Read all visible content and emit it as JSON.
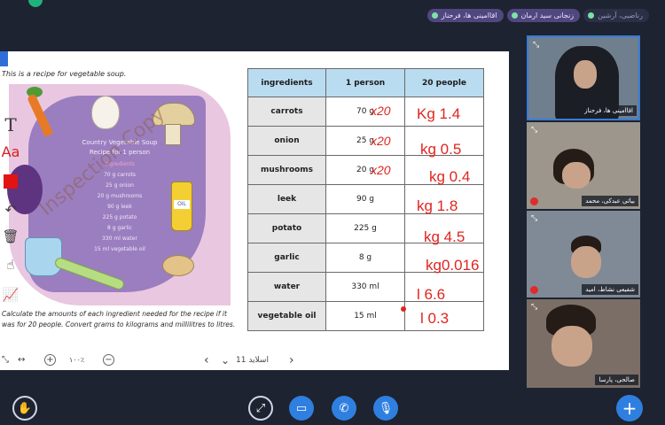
{
  "topbar": {
    "participants": [
      {
        "name": "اقاامینی ها، فرحناز",
        "muted": false
      },
      {
        "name": "زنجانی سید ارمان",
        "muted": false
      },
      {
        "name": "رناضیی، آرشین",
        "muted": true
      }
    ]
  },
  "slide": {
    "intro": "This is a recipe for vegetable soup.",
    "poster_title_1": "Country Vegetable Soup",
    "poster_title_2": "Recipe for 1 person",
    "poster_lines": [
      "Ingredients",
      "70 g carrots",
      "25 g onion",
      "20 g mushrooms",
      "90 g leek",
      "225 g potato",
      "8 g garlic",
      "330 ml water",
      "15 ml vegetable oil"
    ],
    "oil_label": "OIL",
    "watermark": "Inspection Copy",
    "task": "Calculate the amounts of each ingredient needed for the recipe if it was for 20 people. Convert grams to kilograms and millilitres to litres.",
    "table": {
      "headers": [
        "ingredients",
        "1 person",
        "20 people"
      ],
      "rows": [
        {
          "ingredient": "carrots",
          "per_person": "70 g",
          "twenty": ""
        },
        {
          "ingredient": "onion",
          "per_person": "25 g",
          "twenty": ""
        },
        {
          "ingredient": "mushrooms",
          "per_person": "20 g",
          "twenty": ""
        },
        {
          "ingredient": "leek",
          "per_person": "90 g",
          "twenty": ""
        },
        {
          "ingredient": "potato",
          "per_person": "225 g",
          "twenty": ""
        },
        {
          "ingredient": "garlic",
          "per_person": "8 g",
          "twenty": ""
        },
        {
          "ingredient": "water",
          "per_person": "330 ml",
          "twenty": ""
        },
        {
          "ingredient": "vegetable oil",
          "per_person": "15 ml",
          "twenty": ""
        }
      ]
    },
    "ink": {
      "mult": [
        "x20",
        "x20",
        "x20"
      ],
      "answers": [
        "Kg 1.4",
        "kg 0.5",
        "kg 0.4",
        "kg 1.8",
        "kg 4.5",
        "kg0.016",
        "l 6.6",
        "l 0.3"
      ]
    }
  },
  "tools": {
    "text": "T",
    "font": "Aa",
    "undo": "↶",
    "trash": "🗑",
    "hand": "☝",
    "chart": "📈"
  },
  "navbar": {
    "expand": "⤡",
    "fit": "↔",
    "zoom_in": "+",
    "zoom_level": "۱۰۰٪",
    "zoom_out": "−",
    "prev": "‹",
    "slide_label": "اسلاید 11",
    "dropdown": "⌄",
    "next": "›"
  },
  "videos": [
    {
      "name": "اقاامینی ها، فرحناز",
      "muted": false
    },
    {
      "name": "بیاتی عبدکی، محمد",
      "muted": true
    },
    {
      "name": "شفیعی نشاط، امید",
      "muted": true
    },
    {
      "name": "صالحی، پارسا",
      "muted": false
    }
  ],
  "controls": {
    "raise_hand": "✋",
    "screen_share": "⤢",
    "camera": "▭",
    "phone": "✆",
    "mic": "🎙",
    "add": "+"
  }
}
